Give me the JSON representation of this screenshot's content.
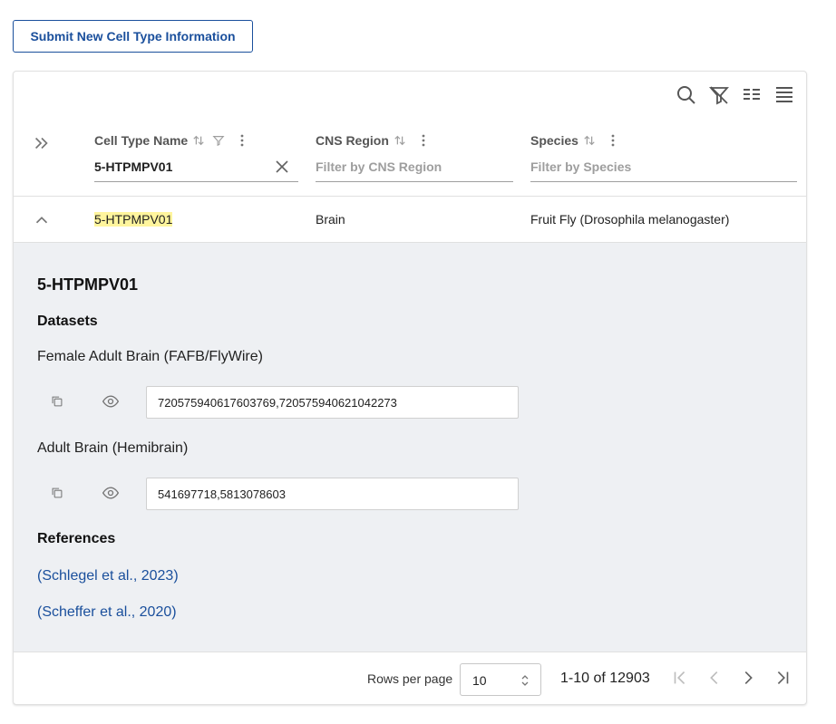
{
  "submit_button": {
    "label": "Submit New Cell Type Information"
  },
  "toolbar": {
    "icons": [
      "search-icon",
      "clear-filters-icon",
      "density-icon",
      "columns-icon"
    ]
  },
  "columns": [
    {
      "title": "Cell Type Name",
      "filter_value": "5-HTPMPV01",
      "placeholder": ""
    },
    {
      "title": "CNS Region",
      "filter_value": "",
      "placeholder": "Filter by CNS Region"
    },
    {
      "title": "Species",
      "filter_value": "",
      "placeholder": "Filter by Species"
    }
  ],
  "row": {
    "cell_type_name": "5-HTPMPV01",
    "cns_region": "Brain",
    "species": "Fruit Fly (Drosophila melanogaster)"
  },
  "detail": {
    "title": "5-HTPMPV01",
    "datasets_heading": "Datasets",
    "datasets": [
      {
        "name": "Female Adult Brain (FAFB/FlyWire)",
        "ids": "720575940617603769,720575940621042273"
      },
      {
        "name": "Adult Brain (Hemibrain)",
        "ids": "541697718,5813078603"
      }
    ],
    "references_heading": "References",
    "references": [
      "(Schlegel et al., 2023)",
      "(Scheffer et al., 2020)"
    ]
  },
  "pagination": {
    "rows_per_page_label": "Rows per page",
    "rows_per_page_value": "10",
    "range_text": "1-10 of 12903"
  },
  "colors": {
    "accent": "#1a4f9c",
    "highlight": "#fff59d",
    "detail_bg": "#eef0f3"
  }
}
